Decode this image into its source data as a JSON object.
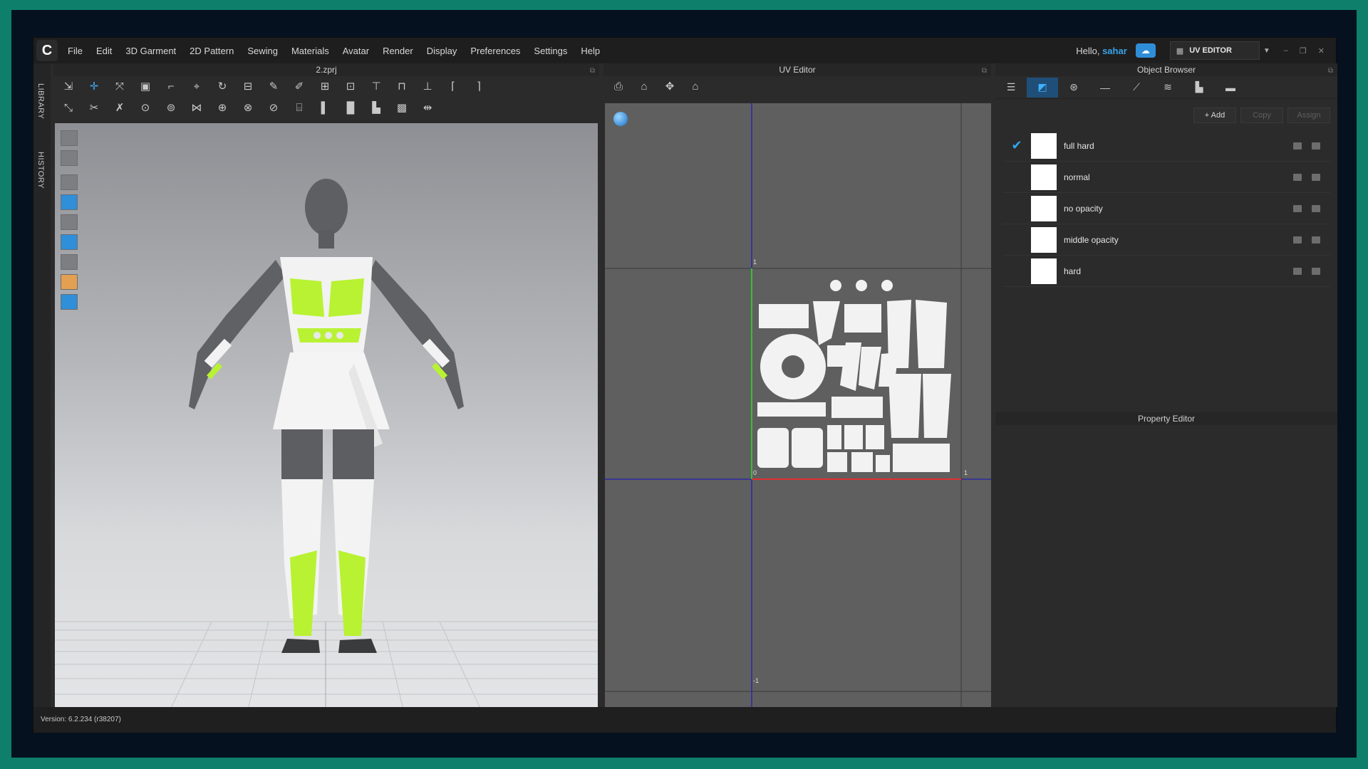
{
  "menu": {
    "items": [
      "File",
      "Edit",
      "3D Garment",
      "2D Pattern",
      "Sewing",
      "Materials",
      "Avatar",
      "Render",
      "Display",
      "Preferences",
      "Settings",
      "Help"
    ],
    "greeting": "Hello, ",
    "username": "sahar",
    "mode_label": "UV EDITOR"
  },
  "sidebar": {
    "tabs": [
      "LIBRARY",
      "HISTORY"
    ]
  },
  "viewport3d": {
    "title": "2.zprj"
  },
  "uv_editor": {
    "title": "UV Editor",
    "axis_labels": {
      "top": "1",
      "origin": "0",
      "right": "1",
      "bottom": "-1"
    }
  },
  "object_browser": {
    "title": "Object Browser",
    "actions": {
      "add": "+ Add",
      "copy": "Copy",
      "assign": "Assign"
    },
    "materials": [
      {
        "name": "full hard",
        "checked": true
      },
      {
        "name": "normal",
        "checked": false
      },
      {
        "name": "no opacity",
        "checked": false
      },
      {
        "name": "middle opacity",
        "checked": false
      },
      {
        "name": "hard",
        "checked": false
      }
    ]
  },
  "property_editor": {
    "title": "Property Editor"
  },
  "status": {
    "version": "Version: 6.2.234 (r38207)"
  },
  "colors": {
    "accent_blue": "#2ea6ee",
    "fabric_lime": "#b8f233",
    "frame_teal": "#0e7f6a",
    "uv_axis_x": "#e03030",
    "uv_axis_y": "#38c038",
    "uv_grid_line": "#2a2aa0"
  }
}
